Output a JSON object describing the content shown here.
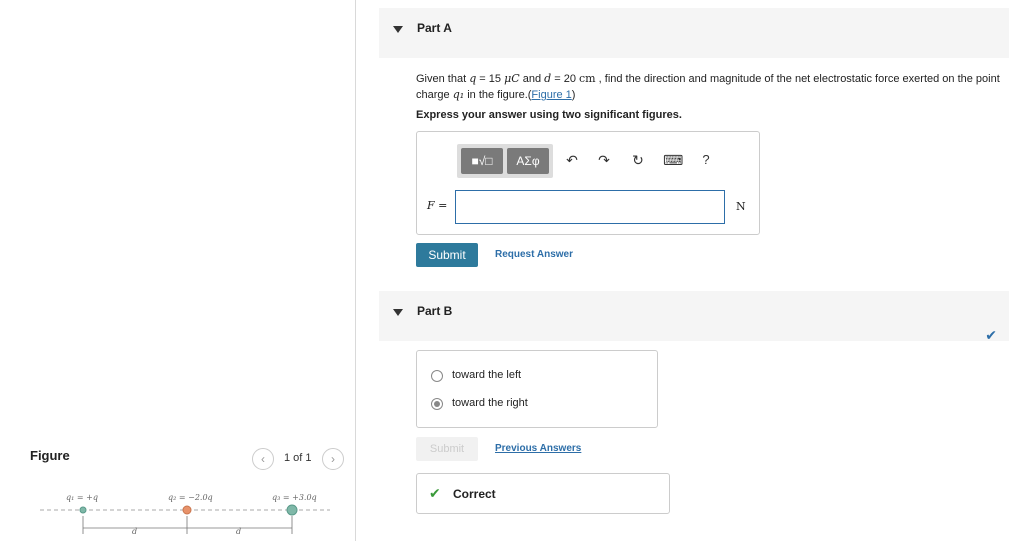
{
  "figure": {
    "title": "Figure",
    "pager": "1 of 1",
    "prev_icon": "‹",
    "next_icon": "›",
    "charges": [
      {
        "label": "q₁ = +q",
        "color": "#7fb8a8"
      },
      {
        "label": "q₂ = −2.0q",
        "color": "#e8926a"
      },
      {
        "label": "q₃ = +3.0q",
        "color": "#7fb8a8"
      }
    ],
    "distance_label": "d"
  },
  "partA": {
    "title": "Part A",
    "question_pre": "Given that ",
    "q_sym": "q",
    "q_val": " = 15 ",
    "q_unit": "μC",
    "and": " and ",
    "d_sym": "d",
    "d_val": " = 20 ",
    "d_unit": "cm",
    "question_post": " , find the direction and magnitude of the net electrostatic force exerted on the point charge ",
    "q1_sym": "q₁",
    "question_tail": " in the figure.(",
    "figure_link": "Figure 1",
    "close_paren": ")",
    "instruction": "Express your answer using two significant figures.",
    "toolbar": {
      "templates": "■√□",
      "greek": "ΑΣφ",
      "undo": "↶",
      "redo": "↷",
      "reset": "↻",
      "keyboard": "⌨",
      "help": "?"
    },
    "field_label": "F =",
    "field_value": "",
    "unit": "N",
    "submit": "Submit",
    "request": "Request Answer"
  },
  "partB": {
    "title": "Part B",
    "check": "✔",
    "options": [
      {
        "label": "toward the left",
        "selected": false
      },
      {
        "label": "toward the right",
        "selected": true
      }
    ],
    "submit": "Submit",
    "previous": "Previous Answers",
    "feedback_icon": "✔",
    "feedback": "Correct"
  }
}
